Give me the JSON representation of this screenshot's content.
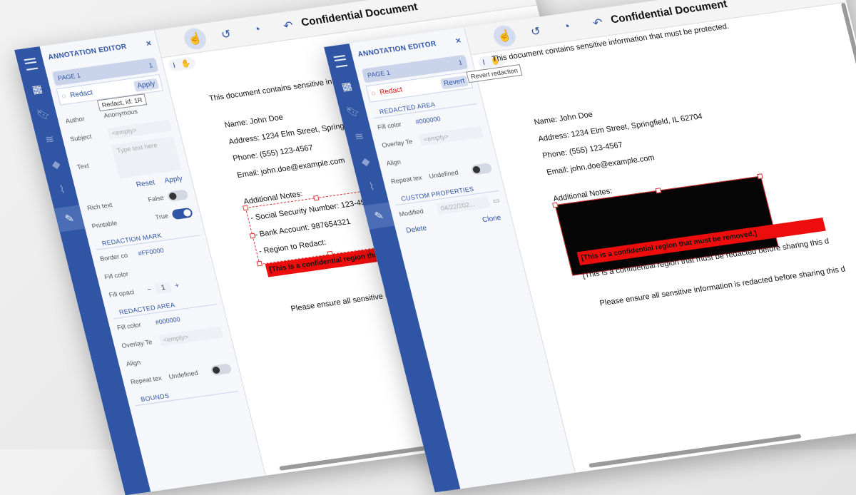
{
  "back": {
    "panel_title": "ANNOTATION EDITOR",
    "close": "×",
    "page_label": "PAGE 1",
    "page_count": "1",
    "annotation_label": "Redact",
    "annotation_action": "Apply",
    "tooltip": "Redact, id: 1R",
    "author_label": "Author",
    "author_value": "Anonymous",
    "subject_label": "Subject",
    "subject_placeholder": "<empty>",
    "text_label": "Text",
    "text_placeholder": "Type text here",
    "reset": "Reset",
    "apply": "Apply",
    "rich_text_label": "Rich text",
    "rich_text_value": "False",
    "printable_label": "Printable",
    "printable_value": "True",
    "section_mark": "REDACTION MARK",
    "border_label": "Border co",
    "border_value": "#FF0000",
    "fill_label": "Fill color",
    "fill_opacity_label": "Fill opaci",
    "fill_opacity_value": "1",
    "section_area": "REDACTED AREA",
    "area_fill_label": "Fill color",
    "area_fill_value": "#000000",
    "overlay_label": "Overlay Te",
    "overlay_placeholder": "<empty>",
    "align_label": "Align",
    "repeat_label": "Repeat tex",
    "repeat_value": "Undefined",
    "section_bounds": "BOUNDS"
  },
  "front": {
    "panel_title": "ANNOTATION EDITOR",
    "close": "×",
    "page_label": "PAGE 1",
    "page_count": "1",
    "annotation_label": "Redact",
    "revert": "Revert",
    "tooltip": "Revert redaction",
    "section_area": "REDACTED AREA",
    "fill_label": "Fill color",
    "fill_value": "#000000",
    "overlay_label": "Overlay Te",
    "overlay_placeholder": "<empty>",
    "align_label": "Align",
    "repeat_label": "Repeat tex",
    "repeat_value": "Undefined",
    "section_custom": "CUSTOM PROPERTIES",
    "modified_label": "Modified",
    "modified_value": "04/22/202...",
    "delete": "Delete",
    "clone": "Clone"
  },
  "document": {
    "title": "Confidential Document",
    "intro": "This document contains sensitive information that must be protected.",
    "intro_short": "This document contains sensitive inform",
    "name": "Name: John Doe",
    "address": "Address: 1234 Elm Street, Springfield, IL 62704",
    "address_short": "Address: 1234 Elm Street, Springfield, I",
    "phone": "Phone: (555) 123-4567",
    "email": "Email: john.doe@example.com",
    "notes": "Additional Notes:",
    "ssn": "- Social Security Number: 123-45-6789",
    "bank": "- Bank Account: 987654321",
    "region": "- Region to Redact:",
    "red_text_short": "[This is a confidential region that must",
    "red_text": "[This is a confidential region that must be removed.]",
    "after_red": "[This is a confidential region that must be redacted before sharing this do",
    "after_red_short": "[This is a confidential region that must be redacted before sharing this d",
    "footer": "Please ensure all sensitive information is redacted before sharing this d"
  },
  "colors": {
    "brand": "#2f55a4",
    "redaction_red": "#ee0d0d",
    "redacted_black": "#050505"
  }
}
